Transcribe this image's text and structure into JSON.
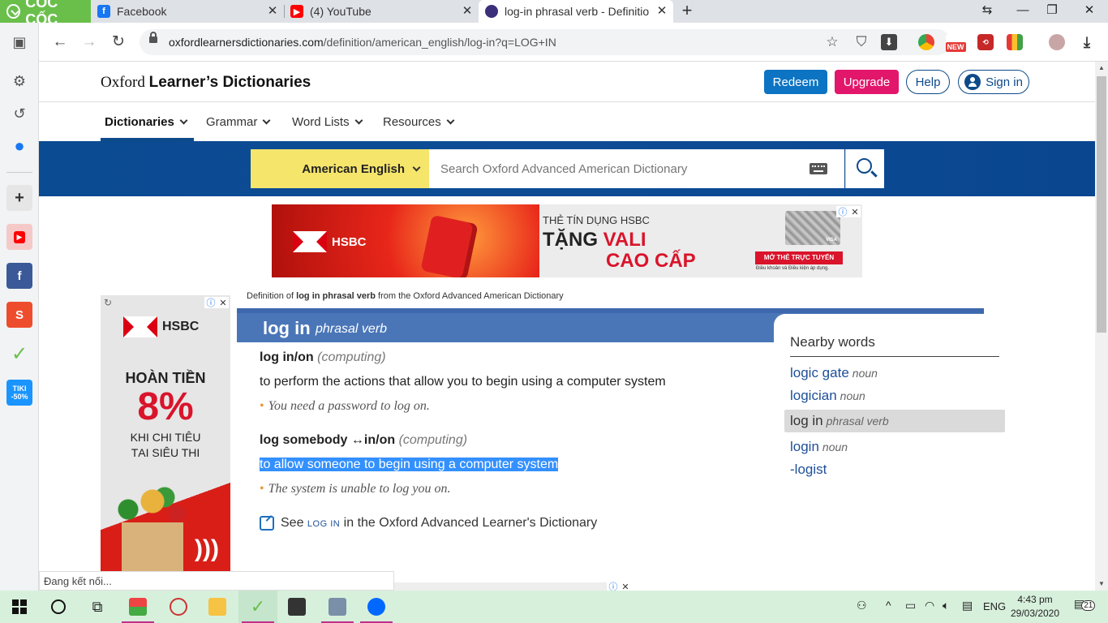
{
  "browser": {
    "brand": "CỐC CỐC",
    "tabs": [
      {
        "title": "Facebook",
        "icon": "facebook-icon"
      },
      {
        "title": "(4) YouTube",
        "icon": "youtube-icon"
      },
      {
        "title": "log-in phrasal verb - Definitio",
        "icon": "oxford-icon",
        "active": true
      }
    ],
    "url_host": "oxfordlearnersdictionaries.com",
    "url_path": "/definition/american_english/log-in?q=LOG+IN",
    "ext_new_badge": "NEW",
    "sidebar_tiki": "TIKI -50%"
  },
  "header": {
    "logo_light": "Oxford ",
    "logo_bold": "Learner’s Dictionaries",
    "redeem": "Redeem",
    "upgrade": "Upgrade",
    "help": "Help",
    "signin": "Sign in"
  },
  "menu": {
    "items": [
      "Dictionaries",
      "Grammar",
      "Word Lists",
      "Resources"
    ],
    "active": "Dictionaries"
  },
  "search": {
    "dictionary": "American English",
    "placeholder": "Search Oxford Advanced American Dictionary"
  },
  "ads": {
    "top": {
      "brand": "HSBC",
      "line1": "THẺ TÍN DỤNG HSBC",
      "line2a": "TẶNG ",
      "line2b": "VALI",
      "line3": "CAO CẤP",
      "card_brand": "VISA",
      "cta": "MỞ THẺ TRỰC TUYẾN",
      "fine": "Điều khoản và Điều kiện áp dụng."
    },
    "left": {
      "brand": "HSBC",
      "line1": "HOÀN TIỀN",
      "line2": "8%",
      "line3": "KHI CHI TIÊU",
      "line4": "TẠI SIÊU THỊ"
    }
  },
  "entry": {
    "crumb_pre": "Definition of ",
    "crumb_word": "log in phrasal verb",
    "crumb_post": " from the Oxford Advanced American Dictionary",
    "headword": "log in",
    "pos": "phrasal verb",
    "senses": [
      {
        "grammar": "log in/on",
        "label": "(computing)",
        "definition": "to perform the actions that allow you to begin using a computer system",
        "example": "You need a password to log on."
      },
      {
        "grammar": "log somebody ↔in/on",
        "label": "(computing)",
        "definition": "to allow someone to begin using a computer system",
        "example": "The system is unable to log you on."
      }
    ],
    "see_pre": "See ",
    "see_link": "LOG IN",
    "see_post": " in the Oxford Advanced Learner's Dictionary"
  },
  "nearby": {
    "title": "Nearby words",
    "items": [
      {
        "word": "logic gate",
        "pos": "noun"
      },
      {
        "word": "logician",
        "pos": "noun"
      },
      {
        "word": "log in",
        "pos": "phrasal verb",
        "current": true
      },
      {
        "word": "login",
        "pos": "noun"
      },
      {
        "word": "-logist",
        "pos": ""
      }
    ]
  },
  "status_text": "Đang kết nối...",
  "taskbar": {
    "language": "ENG",
    "time": "4:43 pm",
    "date": "29/03/2020",
    "notifications": "21"
  },
  "colors": {
    "brand_green": "#6abf4b",
    "oxford_blue": "#0d4a8a",
    "redeem_blue": "#0d74c3",
    "upgrade_pink": "#e2166b",
    "search_yellow": "#f5e56b",
    "entry_blue": "#4a76b8",
    "selection": "#3390ff"
  }
}
